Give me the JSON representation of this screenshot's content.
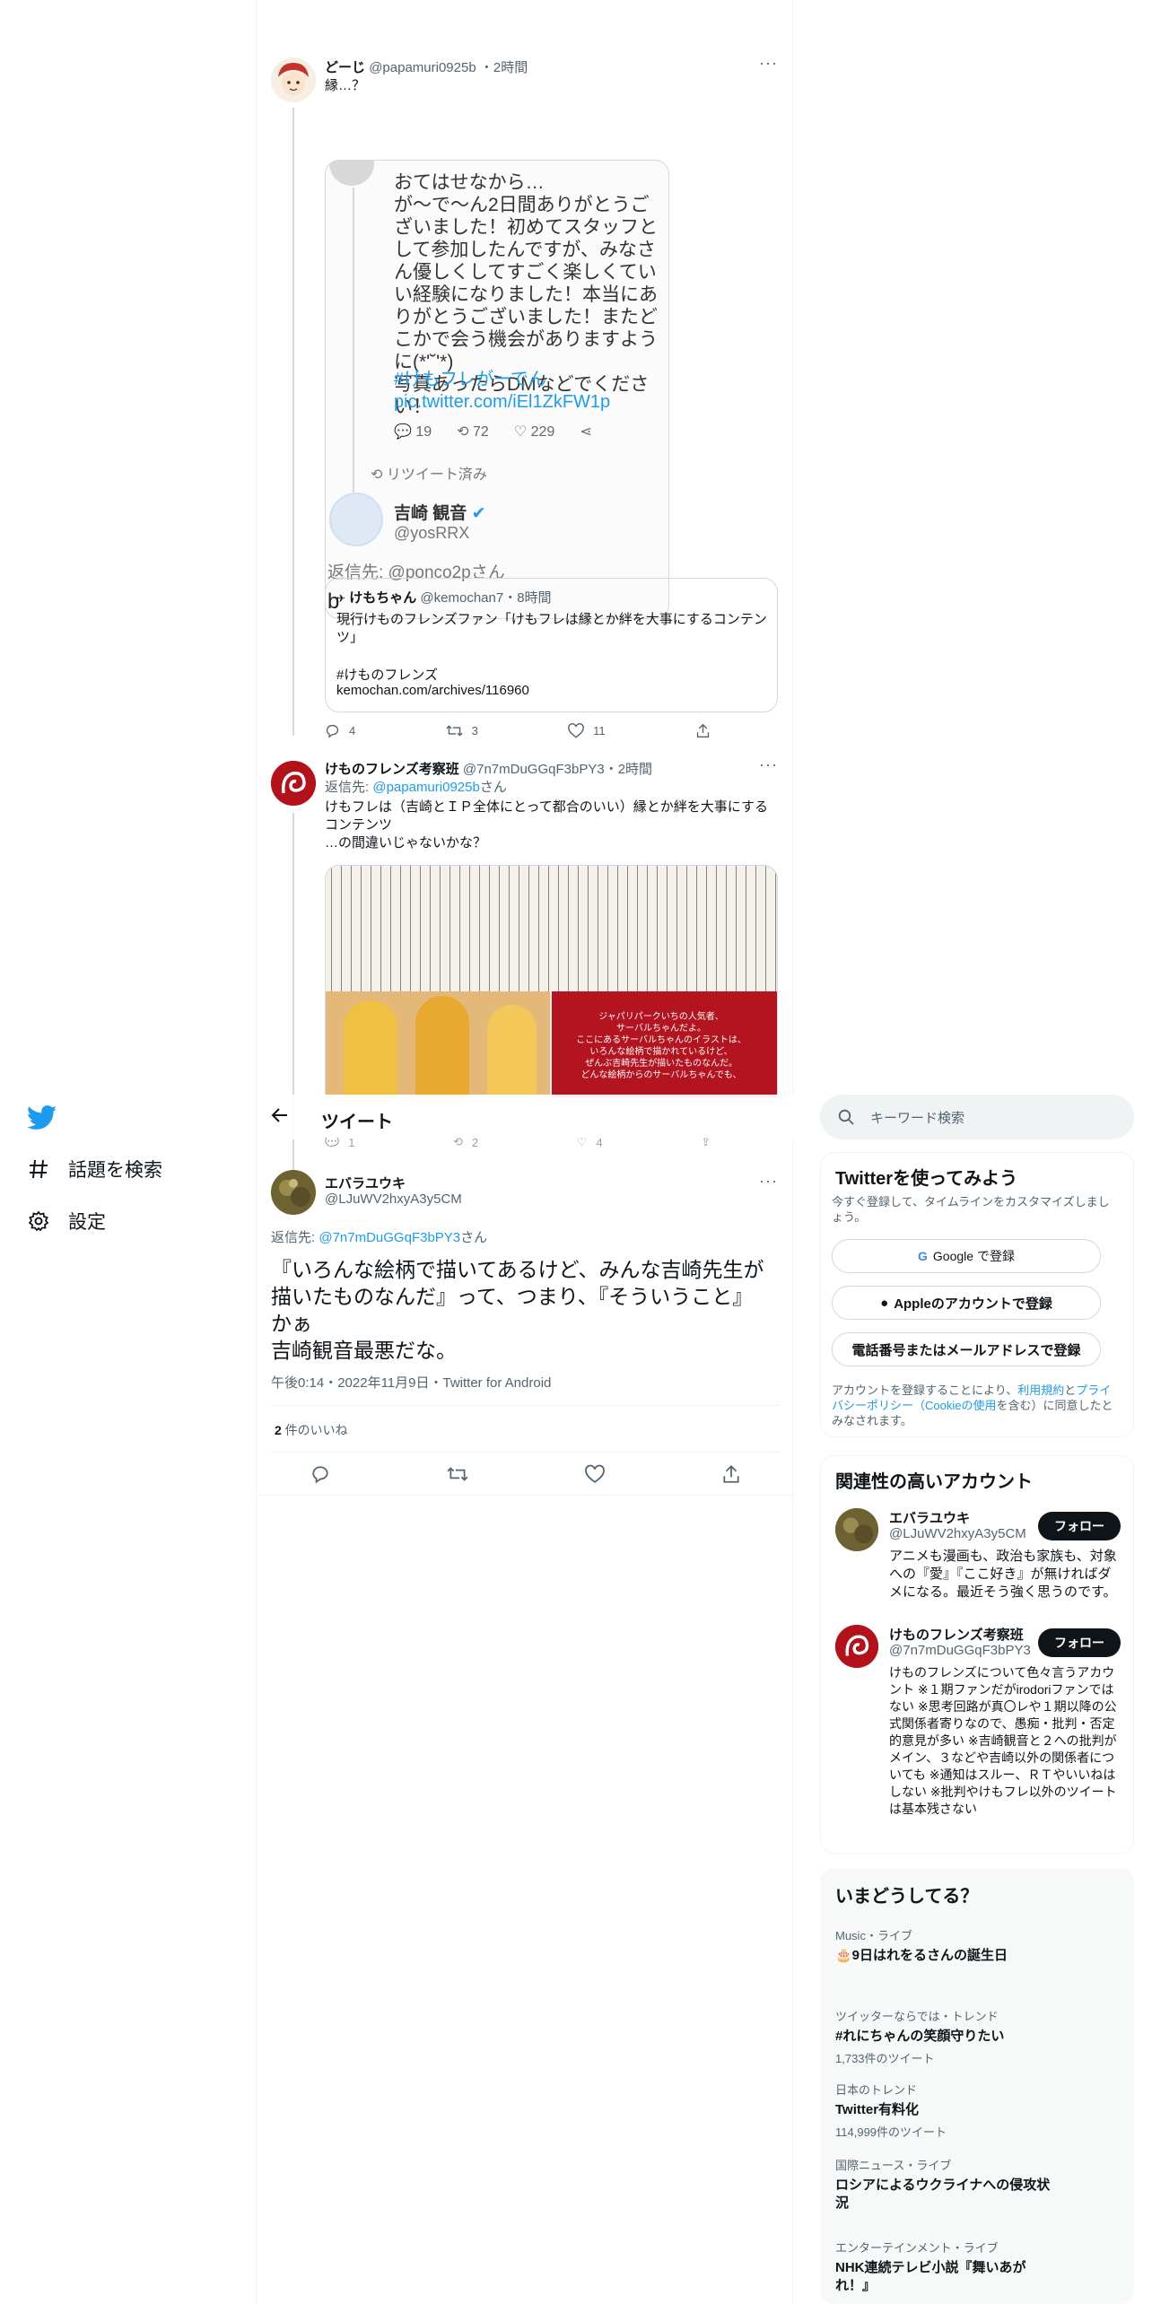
{
  "nav": {
    "explore_label": "話題を検索",
    "settings_label": "設定"
  },
  "tweet1": {
    "name": "どーじ",
    "handle": "@papamuri0925b",
    "time": "2時間",
    "text": "縁…？",
    "image_text": "おてはせなから…\nが〜で〜ん2日間ありがとうございました！初めてスタッフとして参加したんですが、みなさん優しくしてすごく楽しくていい経験になりました！本当にありがとうございました！またどこかで会う機会がありますように(*'˘'*)\n写真あったらDMなどでください！",
    "image_hashtag": "#けもフレがーでん pic.twitter.com/iEl1ZkFW1p",
    "image_counts": {
      "reply": "19",
      "retweet": "72",
      "like": "229"
    },
    "image_retweeted": "リツイート済み",
    "image_user_name": "吉崎 観音",
    "image_user_handle": "@yosRRX",
    "image_reply_to": "返信先: @ponco2pさん",
    "image_b": "b",
    "quote": {
      "name": "けもちゃん",
      "handle": "@kemochan7",
      "time": "8時間",
      "text": "現行けものフレンズファン「けもフレは縁とか絆を大事にするコンテンツ」",
      "hashtag": "#けものフレンズ",
      "link": "kemochan.com/archives/116960"
    },
    "counts": {
      "reply": "4",
      "retweet": "3",
      "like": "11"
    }
  },
  "tweet2": {
    "name": "けものフレンズ考察班",
    "handle": "@7n7mDuGGqF3bPY3",
    "time": "2時間",
    "reply_prefix": "返信先: ",
    "reply_to": "@papamuri0925b",
    "reply_suffix": "さん",
    "text": "けもフレは（吉崎とＩＰ全体にとって都合のいい）縁とか絆を大事にするコンテンツ\n…の間違いじゃないかな？",
    "image_right_caption": "ジャパリパークいちの人気者、\nサーバルちゃんだよ。\nここにあるサーバルちゃんのイラストは、\nいろんな絵柄で描かれているけど、\nぜんぶ吉崎先生が描いたものなんだ。\nどんな絵柄からのサーバルちゃんでも、",
    "counts": {
      "reply": "1",
      "retweet": "2",
      "like": "4"
    }
  },
  "header": {
    "title": "ツイート"
  },
  "main_tweet": {
    "name": "エバラユウキ",
    "handle": "@LJuWV2hxyA3y5CM",
    "reply_prefix": "返信先: ",
    "reply_to": "@7n7mDuGGqF3bPY3",
    "reply_suffix": "さん",
    "text": "『いろんな絵柄で描いてあるけど、みんな吉崎先生が描いたものなんだ』って、つまり、『そういうこと』かぁ\n吉崎観音最悪だな。",
    "timestamp": "午後0:14・2022年11月9日・Twitter for Android",
    "likes_count": "2",
    "likes_label": " 件のいいね"
  },
  "search": {
    "placeholder": "キーワード検索"
  },
  "signup": {
    "title": "Twitterを使ってみよう",
    "subtitle": "今すぐ登録して、タイムラインをカスタマイズしましょう。",
    "google": "Google で登録",
    "apple": "Appleのアカウントで登録",
    "phone": "電話番号またはメールアドレスで登録",
    "terms_1": "アカウントを登録することにより、",
    "terms_link1": "利用規約",
    "terms_2": "と",
    "terms_link2": "プライバシーポリシー（Cookieの使用",
    "terms_3": "を含む）に同意したとみなされます。"
  },
  "related": {
    "title": "関連性の高いアカウント",
    "accounts": [
      {
        "name": "エバラユウキ",
        "handle": "@LJuWV2hxyA3y5CM",
        "bio": "アニメも漫画も、政治も家族も、対象への『愛』『ここ好き』が無ければダメになる。最近そう強く思うのです。",
        "follow": "フォロー"
      },
      {
        "name": "けものフレンズ考察班",
        "handle": "@7n7mDuGGqF3bPY3",
        "bio": "けものフレンズについて色々言うアカウント ※１期ファンだがirodoriファンではない ※思考回路が真〇レや１期以降の公式関係者寄りなので、愚痴・批判・否定的意見が多い ※吉崎観音と２への批判がメイン、３などや吉崎以外の関係者についても ※通知はスルー、ＲＴやいいねはしない ※批判やけもフレ以外のツイートは基本残さない",
        "follow": "フォロー"
      }
    ]
  },
  "trends": {
    "title": "いまどうしてる？",
    "items": [
      {
        "meta": "Music・ライブ",
        "title": "🎂9日はれをるさんの誕生日",
        "count": ""
      },
      {
        "meta": "ツイッターならでは・トレンド",
        "title": "#れにちゃんの笑顔守りたい",
        "count": "1,733件のツイート"
      },
      {
        "meta": "日本のトレンド",
        "title": "Twitter有料化",
        "count": "114,999件のツイート"
      },
      {
        "meta": "国際ニュース・ライブ",
        "title": "ロシアによるウクライナへの侵攻状況",
        "count": ""
      },
      {
        "meta": "エンターテインメント・ライブ",
        "title": "NHK連続テレビ小説『舞いあがれ！』",
        "count": ""
      }
    ]
  },
  "colors": {
    "accent": "#1d9bf0",
    "text": "#0f1419",
    "secondary": "#536471",
    "border": "#eff3f4"
  }
}
